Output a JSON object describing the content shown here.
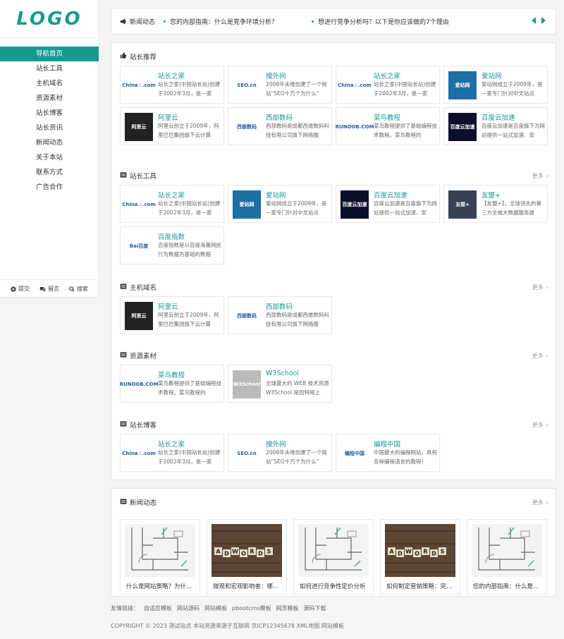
{
  "logo": "LOGO",
  "nav": [
    "导航首页",
    "站长工具",
    "主机域名",
    "资源素材",
    "站长博客",
    "站长资讯",
    "新闻动态",
    "关于本站",
    "联系方式",
    "广告合作"
  ],
  "sidebar_foot": [
    "提交",
    "留言",
    "搜索"
  ],
  "ticker": {
    "tag": "新闻动态",
    "items": [
      "您的内部指南：什么是竞争环境分析？",
      "想进行竞争分析吗？以下是你应该做的7个理由"
    ]
  },
  "recommend": {
    "title": "站长推荐",
    "cards": [
      {
        "name": "站长之家",
        "desc": "站长之家(中国站长站)创建于2002年3月，是一家",
        "logo": "China☆.com",
        "style": "white"
      },
      {
        "name": "搜外网",
        "desc": "2008年夫唯创建了一个网站“SEO十万个为什么”",
        "logo": "SEO.cn",
        "style": "white"
      },
      {
        "name": "站长之家",
        "desc": "站长之家(中国站长站)创建于2002年3月，是一家",
        "logo": "China☆.com",
        "style": "white"
      },
      {
        "name": "爱站网",
        "desc": "爱站网成立于2009年，是一家专门针对中文站点",
        "logo": "爱站网",
        "style": "blue"
      },
      {
        "name": "阿里云",
        "desc": "阿里云创立于2009年，阿里巴巴集团旗下云计算",
        "logo": "阿里云",
        "style": "dark"
      },
      {
        "name": "西部数码",
        "desc": "西部数码是成都西维数码科技有限公司旗下网络服",
        "logo": "西部数码",
        "style": "white"
      },
      {
        "name": "菜鸟教程",
        "desc": "菜鸟教程提供了基础编程技术教程。菜鸟教程的",
        "logo": "RUNOOB.COM",
        "style": "white"
      },
      {
        "name": "百度云加速",
        "desc": "百度云加速是百度旗下为网站提供一站式加速、安",
        "logo": "百度云加速",
        "style": "navy"
      }
    ]
  },
  "tools": {
    "title": "站长工具",
    "more": "更多",
    "cards": [
      {
        "name": "站长之家",
        "desc": "站长之家(中国站长站)创建于2002年3月，是一家",
        "logo": "China☆.com",
        "style": "white"
      },
      {
        "name": "爱站网",
        "desc": "爱站网成立于2009年，是一家专门针对中文站点",
        "logo": "爱站网",
        "style": "blue"
      },
      {
        "name": "百度云加速",
        "desc": "百度云加速是百度旗下为网站提供一站式加速、安",
        "logo": "百度云加速",
        "style": "navy"
      },
      {
        "name": "友盟+",
        "desc": "【友盟+】，全球领先的第三方全域大数据服务提",
        "logo": "友盟+",
        "style": "slate"
      },
      {
        "name": "百度指数",
        "desc": "百度指数是以百度海量网民行为数据为基础的数据",
        "logo": "Bai百度",
        "style": "white"
      }
    ]
  },
  "hosting": {
    "title": "主机域名",
    "more": "更多",
    "cards": [
      {
        "name": "阿里云",
        "desc": "阿里云创立于2009年，阿里巴巴集团旗下云计算",
        "logo": "阿里云",
        "style": "dark"
      },
      {
        "name": "西部数码",
        "desc": "西部数码是成都西维数码科技有限公司旗下网络服",
        "logo": "西部数码",
        "style": "white"
      }
    ]
  },
  "resources": {
    "title": "资源素材",
    "more": "更多",
    "cards": [
      {
        "name": "菜鸟教程",
        "desc": "菜鸟教程提供了基础编程技术教程。菜鸟教程的",
        "logo": "RUNOOB.COM",
        "style": "white"
      },
      {
        "name": "W3School",
        "desc": "全球最大的 WEB 技术资源W3School 是因特网上",
        "logo": "W3School",
        "style": "gray"
      }
    ]
  },
  "blog": {
    "title": "站长博客",
    "more": "更多",
    "cards": [
      {
        "name": "站长之家",
        "desc": "站长之家(中国站长站)创建于2002年3月，是一家",
        "logo": "China☆.com",
        "style": "white"
      },
      {
        "name": "搜外网",
        "desc": "2008年夫唯创建了一个网站“SEO十万个为什么”",
        "logo": "SEO.cn",
        "style": "white"
      },
      {
        "name": "编程中国",
        "desc": "中国最大的编程网站，具有各种编程语言的教程！",
        "logo": "编程中国",
        "style": "white"
      }
    ]
  },
  "news": {
    "title": "新闻动态",
    "more": "更多",
    "items": [
      {
        "caption": "什么是网站策略？为什么需要网站策略",
        "img": "blueprint"
      },
      {
        "caption": "微观和宏观影响者：哪个适合你",
        "img": "adwords"
      },
      {
        "caption": "如何进行竞争性定价分析",
        "img": "blueprint"
      },
      {
        "caption": "如何制定营销策略：完整指南",
        "img": "adwords"
      },
      {
        "caption": "您的内部指南：什么是竞争环境分析？",
        "img": "blueprint"
      }
    ],
    "adwords_text": "ADWORDS"
  },
  "footer": {
    "links_label": "友情链接：",
    "links": [
      "自适应模板",
      "网站源码",
      "网站模板",
      "pbootcms模板",
      "网页模板",
      "源码下载"
    ],
    "copyright": "COPYRIGHT © 2023 测试站点 本站资源来源于互联网 京ICP12345678 XML地图 网站模板"
  }
}
